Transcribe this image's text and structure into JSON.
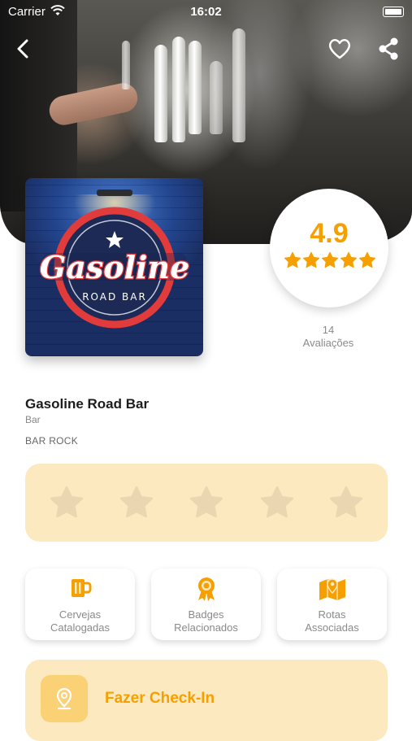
{
  "status_bar": {
    "carrier": "Carrier",
    "time": "16:02"
  },
  "logo": {
    "brand_text": "Gasoline",
    "sub_text": "ROAD BAR"
  },
  "rating": {
    "value": "4.9",
    "stars": 5,
    "reviews_count": "14",
    "reviews_label": "Avaliações"
  },
  "place": {
    "name": "Gasoline Road Bar",
    "type": "Bar",
    "tag": "BAR ROCK"
  },
  "user_rating": {
    "stars": 5,
    "selected": 0
  },
  "actions": [
    {
      "label_line1": "Cervejas",
      "label_line2": "Catalogadas",
      "icon": "beer-mug-icon"
    },
    {
      "label_line1": "Badges",
      "label_line2": "Relacionados",
      "icon": "award-badge-icon"
    },
    {
      "label_line1": "Rotas",
      "label_line2": "Associadas",
      "icon": "map-pin-icon"
    }
  ],
  "checkin": {
    "label": "Fazer Check-In",
    "icon": "location-pin-icon"
  },
  "colors": {
    "accent": "#f5a000",
    "soft_accent": "#fde9bf",
    "icon_box": "#fbd176",
    "star_inactive": "#ead6b0"
  }
}
